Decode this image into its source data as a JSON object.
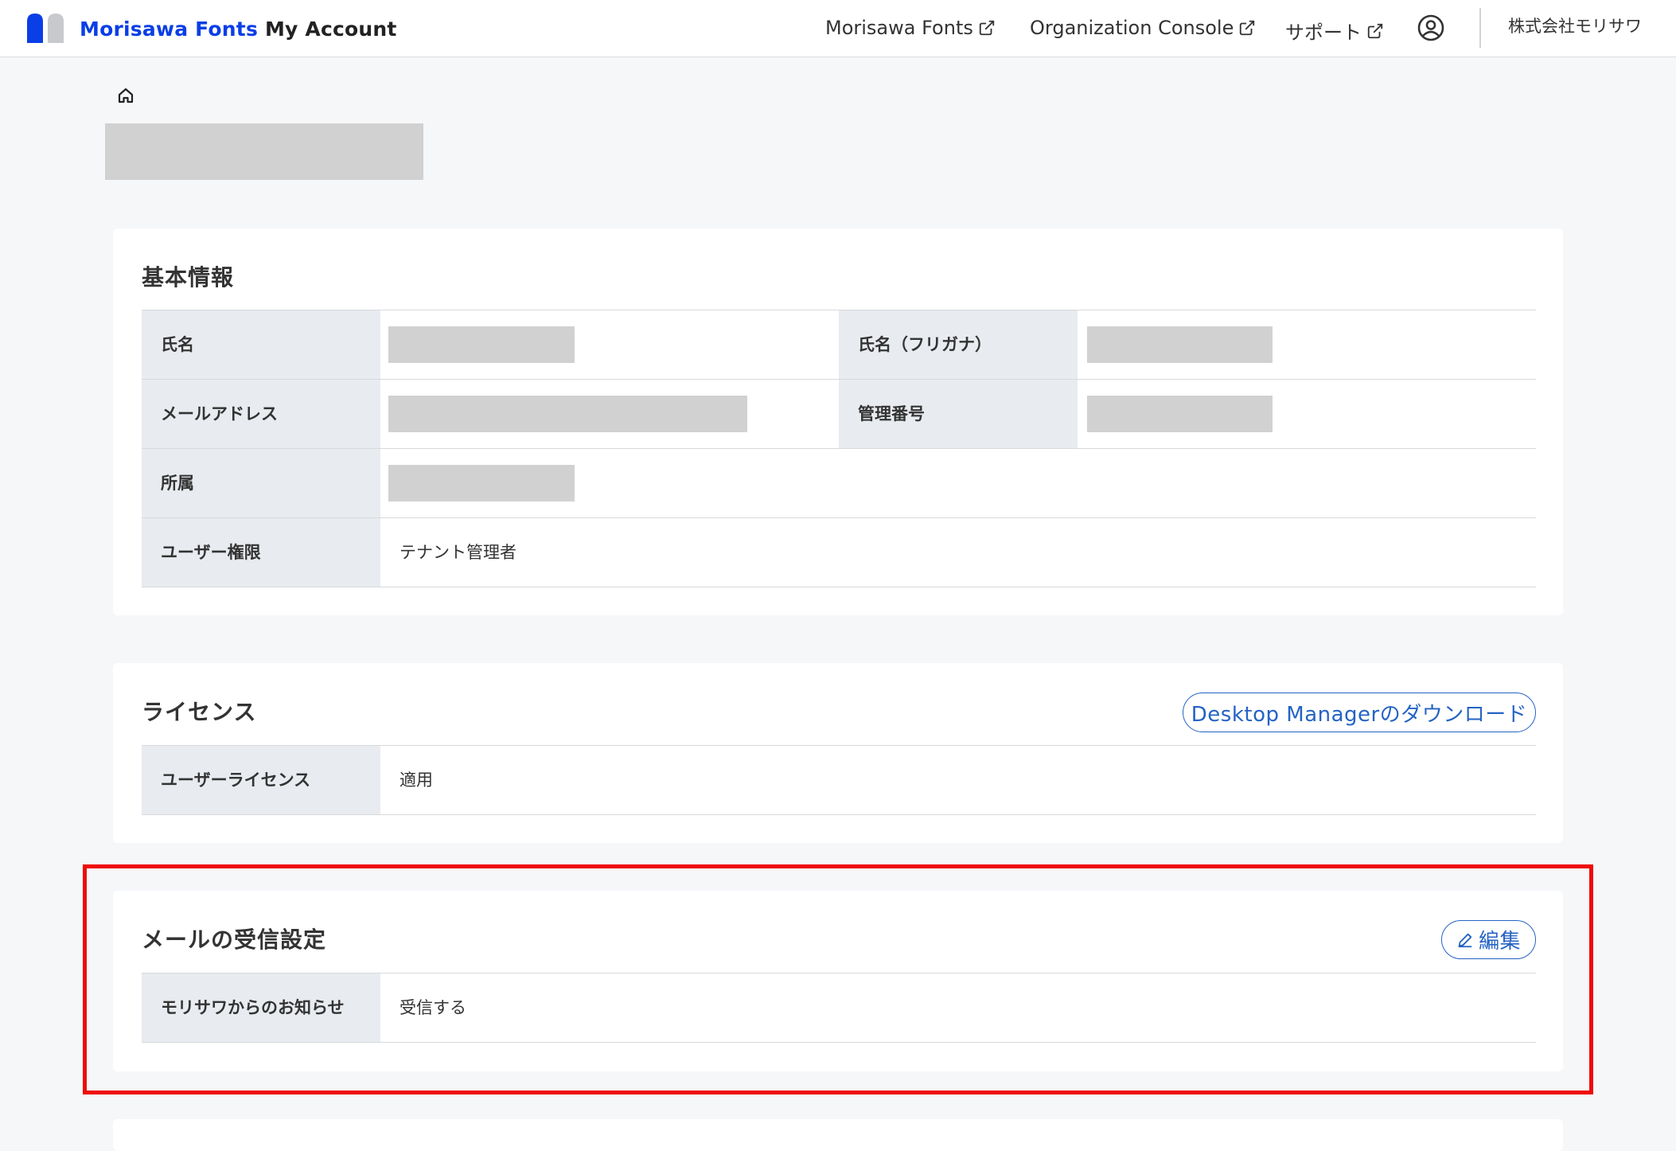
{
  "header": {
    "brand_part1": "Morisawa Fonts",
    "brand_part2": "My Account",
    "nav_links": [
      {
        "label": "Morisawa Fonts"
      },
      {
        "label": "Organization Console"
      },
      {
        "label": "サポート"
      }
    ],
    "org_name": "株式会社モリサワ"
  },
  "basic_info": {
    "title": "基本情報",
    "rows": [
      {
        "label": "氏名",
        "label2": "氏名（フリガナ）"
      },
      {
        "label": "メールアドレス",
        "label2": "管理番号"
      },
      {
        "label": "所属"
      },
      {
        "label": "ユーザー権限",
        "value": "テナント管理者"
      }
    ]
  },
  "license": {
    "title": "ライセンス",
    "download_button": "Desktop Managerのダウンロード",
    "rows": [
      {
        "label": "ユーザーライセンス",
        "value": "適用"
      }
    ]
  },
  "mail_settings": {
    "title": "メールの受信設定",
    "edit_button": "編集",
    "rows": [
      {
        "label": "モリサワからのお知らせ",
        "value": "受信する"
      }
    ]
  },
  "colors": {
    "brand_blue": "#0a3ee6",
    "link_blue": "#2563c4",
    "highlight_red": "#ee0b0b",
    "label_bg": "#e8ebef",
    "page_bg": "#f6f7f9"
  },
  "icons": [
    "logo-icon",
    "external-link-icon",
    "user-circle-icon",
    "home-icon",
    "pencil-icon"
  ]
}
